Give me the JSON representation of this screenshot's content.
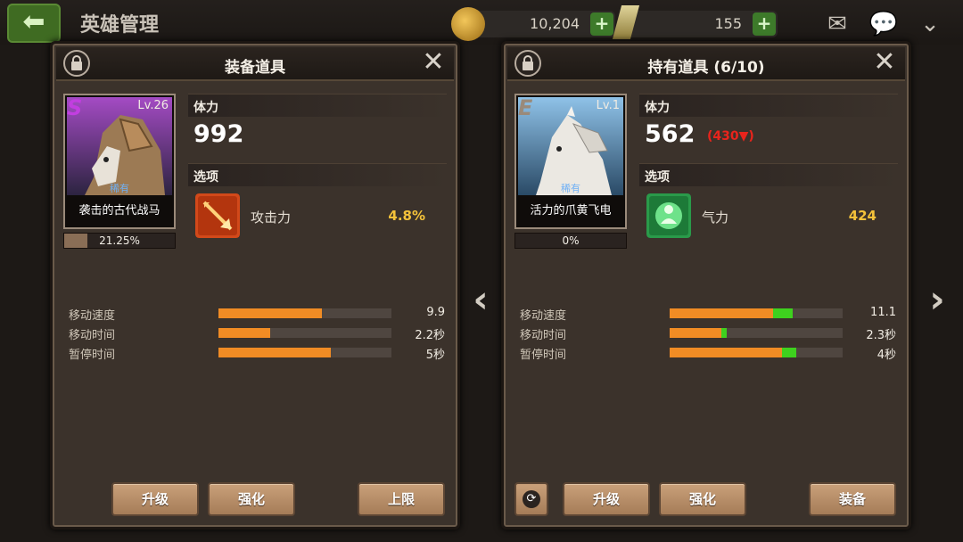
{
  "header": {
    "title": "英雄管理",
    "back_icon": "back-arrow-icon",
    "gold": "10,204",
    "gems": "155",
    "plus_label": "+",
    "mail_icon": "mail-icon",
    "chat_icon": "chat-icon",
    "collapse_icon": "chevron-down-icon"
  },
  "left_panel": {
    "title": "装备道具",
    "close_label": "✕",
    "item": {
      "grade": "S",
      "grade_color": "#c23ee0",
      "level": "Lv.26",
      "rarity": "稀有",
      "name": "袭击的古代战马",
      "progress_text": "21.25%",
      "progress": 0.2125
    },
    "hp": {
      "label": "体力",
      "value": "992"
    },
    "option": {
      "label": "选项",
      "name": "攻击力",
      "value": "4.8%",
      "icon": "attack-arrow-icon"
    },
    "stats": [
      {
        "label": "移动速度",
        "value": "9.9",
        "fill": 0.6,
        "diff": 0
      },
      {
        "label": "移动时间",
        "value": "2.2秒",
        "fill": 0.3,
        "diff": 0
      },
      {
        "label": "暂停时间",
        "value": "5秒",
        "fill": 0.65,
        "diff": 0
      }
    ],
    "buttons": {
      "upgrade": "升级",
      "enhance": "强化",
      "limit": "上限"
    }
  },
  "right_panel": {
    "title": "持有道具 (6/10)",
    "close_label": "✕",
    "item": {
      "grade": "E",
      "grade_color": "#9a8a7a",
      "level": "Lv.1",
      "rarity": "稀有",
      "name": "活力的爪黄飞电",
      "progress_text": "0%",
      "progress": 0
    },
    "hp": {
      "label": "体力",
      "value": "562",
      "delta": "(430▼)"
    },
    "option": {
      "label": "选项",
      "name": "气力",
      "value": "424",
      "icon": "spirit-icon"
    },
    "stats": [
      {
        "label": "移动速度",
        "value": "11.1",
        "fill": 0.6,
        "diff": 0.11
      },
      {
        "label": "移动时间",
        "value": "2.3秒",
        "fill": 0.3,
        "diff": 0.03
      },
      {
        "label": "暂停时间",
        "value": "4秒",
        "fill": 0.65,
        "diff": 0.08
      }
    ],
    "buttons": {
      "upgrade": "升级",
      "enhance": "强化",
      "equip": "装备"
    },
    "sort_icon": "sort-icon"
  },
  "nav": {
    "prev_label": "‹",
    "next_label": "›"
  }
}
